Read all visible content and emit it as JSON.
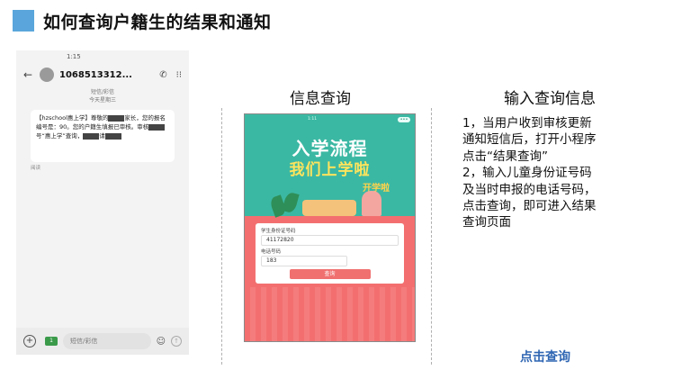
{
  "page": {
    "title": "如何查询户籍生的结果和通知",
    "accent_color": "#5aa6dc",
    "link_color": "#2f66b3"
  },
  "phone": {
    "status_time": "1:15",
    "back_icon": "arrow-left-icon",
    "contact_number": "1068513312...",
    "call_icon": "phone-icon",
    "more_icon": "more-icon",
    "meta_line1": "短信/彩信",
    "meta_line2": "今天星期三",
    "message_parts": [
      "【hzschool惠上学】尊敬的",
      "家长，您的报名编号是：90。您的户籍生填报已审核。审核",
      "号“惠上学”查询，",
      "请"
    ],
    "read_receipt": "阅读",
    "input_placeholder": "短信/彩信",
    "sim_label": "1"
  },
  "sections": {
    "info_query": "信息查询",
    "input_query": "输入查询信息"
  },
  "mini_program": {
    "status_text": "1:11",
    "headline1": "入学流程",
    "headline2": "我们上学啦",
    "tagline": "开学啦",
    "student_id_label": "学生身份证号码",
    "student_id_value": "41172820",
    "phone_label": "电话号码",
    "phone_value": "183",
    "query_button": "查询"
  },
  "steps": {
    "line1": "1，当用户收到审核更新",
    "line2": "通知短信后，打开小程序",
    "line3": "点击“结果查询”",
    "line4": "2，输入儿童身份证号码",
    "line5": "及当时申报的电话号码，",
    "line6": "点击查询，即可进入结果",
    "line7": "查询页面"
  },
  "cta": {
    "label": "点击查询"
  }
}
